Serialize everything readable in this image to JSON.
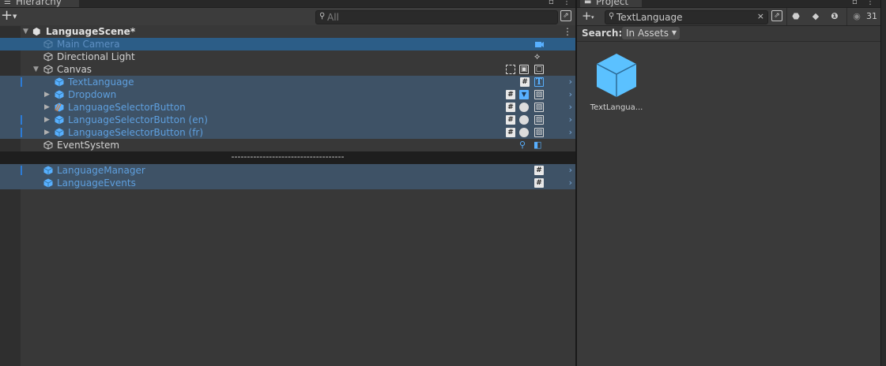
{
  "hierarchy": {
    "tab_title": "Hierarchy",
    "search_placeholder": "All",
    "scene": {
      "name": "LanguageScene*"
    },
    "rows": [
      {
        "label": "Main Camera",
        "selected": true
      },
      {
        "label": "Directional Light"
      },
      {
        "label": "Canvas"
      },
      {
        "label": "TextLanguage"
      },
      {
        "label": "Dropdown"
      },
      {
        "label": "LanguageSelectorButton"
      },
      {
        "label": "LanguageSelectorButton (en)"
      },
      {
        "label": "LanguageSelectorButton (fr)"
      },
      {
        "label": "EventSystem"
      }
    ],
    "separator_text": "------------------------------------",
    "extra_rows": [
      {
        "label": "LanguageManager"
      },
      {
        "label": "LanguageEvents"
      }
    ]
  },
  "project": {
    "tab_title": "Project",
    "search_value": "TextLanguage",
    "search_label": "Search:",
    "scope_chip": "In Assets",
    "visible_count": "31",
    "asset": {
      "label": "TextLangua..."
    }
  },
  "icon_names": [
    "menu-icon",
    "plus-icon",
    "search-icon",
    "scene-icon",
    "gameobject-icon",
    "prefab-icon",
    "script-icon",
    "text-icon",
    "image-icon",
    "toggle-icon",
    "folder-icon",
    "eye-icon"
  ],
  "colors": {
    "selection_bg": "#3e5266",
    "selection_text": "#5e9fde",
    "prefab_blue": "#58b0ff",
    "panel_bg": "#383838"
  }
}
